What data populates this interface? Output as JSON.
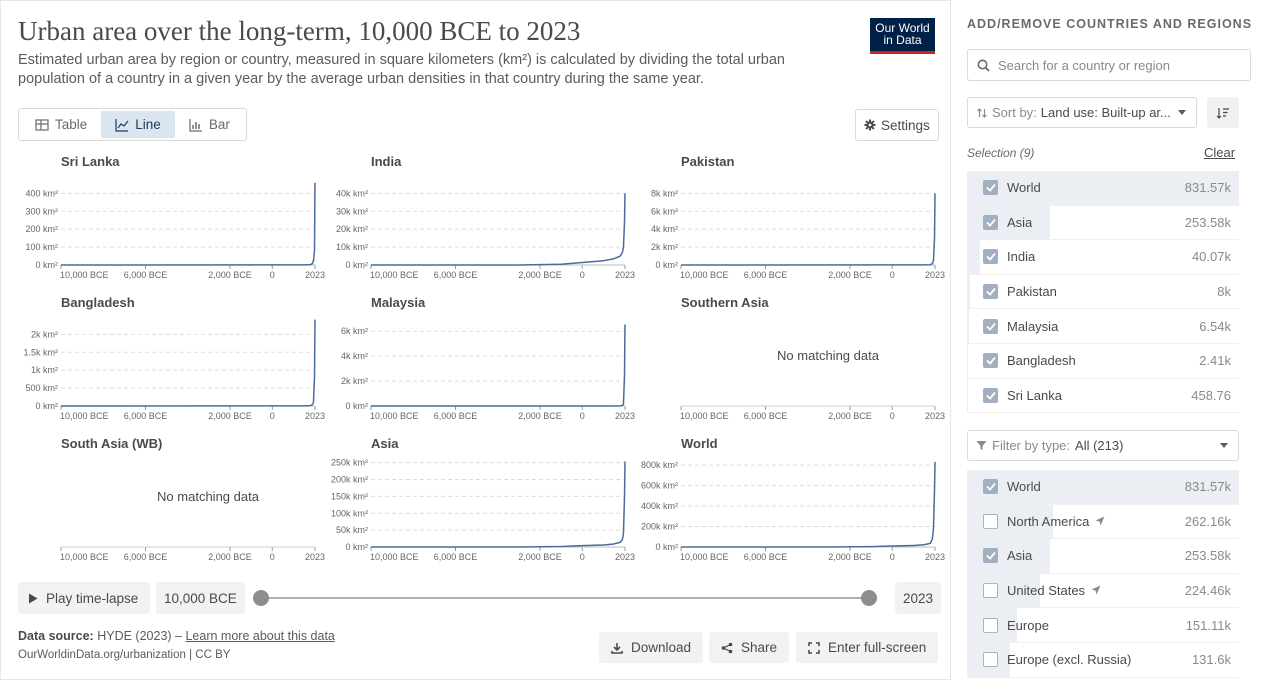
{
  "header": {
    "title": "Urban area over the long-term, 10,000 BCE to 2023",
    "subtitle": "Estimated urban area by region or country, measured in square kilometers (km²) is calculated by dividing the total urban population of a country in a given year by the average urban densities in that country during the same year.",
    "logo_line1": "Our World",
    "logo_line2": "in Data"
  },
  "tabs": [
    {
      "label": "Table",
      "icon": "table-icon",
      "active": false
    },
    {
      "label": "Line",
      "icon": "line-chart-icon",
      "active": true
    },
    {
      "label": "Bar",
      "icon": "bar-chart-icon",
      "active": false
    }
  ],
  "settings_label": "Settings",
  "no_data_text": "No matching data",
  "x_ticks": [
    "10,000 BCE",
    "6,000 BCE",
    "2,000 BCE",
    "0",
    "2023"
  ],
  "chart_data": {
    "type": "line",
    "layout": "small-multiples",
    "x_range": [
      -10000,
      2023
    ],
    "x_tick_values": [
      -10000,
      -6000,
      -2000,
      0,
      2023
    ],
    "line_color": "#4c6a9c",
    "grid": "horizontal dashed",
    "panels": [
      {
        "title": "Sri Lanka",
        "has_data": true,
        "y_ticks": [
          "400 km²",
          "300 km²",
          "200 km²",
          "100 km²",
          "0 km²"
        ],
        "y_tick_values": [
          400,
          300,
          200,
          100,
          0
        ],
        "ylim": [
          0,
          480
        ],
        "points": [
          [
            -10000,
            0
          ],
          [
            1500,
            0.5
          ],
          [
            1800,
            2
          ],
          [
            1900,
            8
          ],
          [
            1950,
            25
          ],
          [
            2000,
            80
          ],
          [
            2015,
            350
          ],
          [
            2023,
            458.76
          ]
        ]
      },
      {
        "title": "India",
        "has_data": true,
        "y_ticks": [
          "40k km²",
          "30k km²",
          "20k km²",
          "10k km²",
          "0 km²"
        ],
        "y_tick_values": [
          40000,
          30000,
          20000,
          10000,
          0
        ],
        "ylim": [
          0,
          48000
        ],
        "points": [
          [
            -10000,
            0
          ],
          [
            -3000,
            20
          ],
          [
            -1000,
            400
          ],
          [
            0,
            1400
          ],
          [
            1000,
            2400
          ],
          [
            1500,
            3500
          ],
          [
            1800,
            5000
          ],
          [
            1900,
            7000
          ],
          [
            1950,
            10000
          ],
          [
            2000,
            24000
          ],
          [
            2023,
            40070
          ]
        ]
      },
      {
        "title": "Pakistan",
        "has_data": true,
        "y_ticks": [
          "8k km²",
          "6k km²",
          "4k km²",
          "2k km²",
          "0 km²"
        ],
        "y_tick_values": [
          8000,
          6000,
          4000,
          2000,
          0
        ],
        "ylim": [
          0,
          9600
        ],
        "points": [
          [
            -10000,
            0
          ],
          [
            1500,
            10
          ],
          [
            1800,
            30
          ],
          [
            1900,
            150
          ],
          [
            1950,
            500
          ],
          [
            2000,
            3000
          ],
          [
            2023,
            8000
          ]
        ]
      },
      {
        "title": "Bangladesh",
        "has_data": true,
        "y_ticks": [
          "2k km²",
          "1.5k km²",
          "1k km²",
          "500 km²",
          "0 km²"
        ],
        "y_tick_values": [
          2000,
          1500,
          1000,
          500,
          0
        ],
        "ylim": [
          0,
          2400
        ],
        "points": [
          [
            -10000,
            0
          ],
          [
            1500,
            5
          ],
          [
            1800,
            10
          ],
          [
            1900,
            40
          ],
          [
            1950,
            100
          ],
          [
            2000,
            800
          ],
          [
            2023,
            2410
          ]
        ]
      },
      {
        "title": "Malaysia",
        "has_data": true,
        "y_ticks": [
          "6k km²",
          "4k km²",
          "2k km²",
          "0 km²"
        ],
        "y_tick_values": [
          6000,
          4000,
          2000,
          0
        ],
        "ylim": [
          0,
          6900
        ],
        "points": [
          [
            -10000,
            0
          ],
          [
            1500,
            5
          ],
          [
            1800,
            10
          ],
          [
            1900,
            40
          ],
          [
            1950,
            150
          ],
          [
            2000,
            2500
          ],
          [
            2023,
            6540
          ]
        ]
      },
      {
        "title": "Southern Asia",
        "has_data": false
      },
      {
        "title": "South Asia (WB)",
        "has_data": false
      },
      {
        "title": "Asia",
        "has_data": true,
        "y_ticks": [
          "250k km²",
          "200k km²",
          "150k km²",
          "100k km²",
          "50k km²",
          "0 km²"
        ],
        "y_tick_values": [
          250000,
          200000,
          150000,
          100000,
          50000,
          0
        ],
        "ylim": [
          0,
          255000
        ],
        "points": [
          [
            -10000,
            0
          ],
          [
            -3000,
            100
          ],
          [
            -1000,
            1500
          ],
          [
            0,
            4000
          ],
          [
            1000,
            6000
          ],
          [
            1500,
            9000
          ],
          [
            1800,
            14000
          ],
          [
            1900,
            22000
          ],
          [
            1950,
            40000
          ],
          [
            2000,
            150000
          ],
          [
            2023,
            253580
          ]
        ]
      },
      {
        "title": "World",
        "has_data": true,
        "y_ticks": [
          "800k km²",
          "600k km²",
          "400k km²",
          "200k km²",
          "0 km²"
        ],
        "y_tick_values": [
          800000,
          600000,
          400000,
          200000,
          0
        ],
        "ylim": [
          0,
          840000
        ],
        "points": [
          [
            -10000,
            0
          ],
          [
            -3000,
            300
          ],
          [
            -1000,
            4000
          ],
          [
            0,
            10000
          ],
          [
            1000,
            15000
          ],
          [
            1500,
            22000
          ],
          [
            1800,
            35000
          ],
          [
            1900,
            80000
          ],
          [
            1950,
            180000
          ],
          [
            2000,
            550000
          ],
          [
            2023,
            831570
          ]
        ]
      }
    ]
  },
  "timeline": {
    "play_label": "Play time-lapse",
    "start_label": "10,000 BCE",
    "end_label": "2023"
  },
  "footer": {
    "source_prefix": "Data source:",
    "source_value": "HYDE (2023) –",
    "source_link": "Learn more about this data",
    "url": "OurWorldinData.org/urbanization | CC BY",
    "download_label": "Download",
    "share_label": "Share",
    "fullscreen_label": "Enter full-screen"
  },
  "sidebar": {
    "header": "ADD/REMOVE COUNTRIES AND REGIONS",
    "search_placeholder": "Search for a country or region",
    "sort_prefix": "Sort by:",
    "sort_value": "Land use: Built-up ar...",
    "selection_label": "Selection (9)",
    "clear_label": "Clear",
    "selected": [
      {
        "name": "World",
        "value": "831.57k",
        "checked": true,
        "fraction": 1.0
      },
      {
        "name": "Asia",
        "value": "253.58k",
        "checked": true,
        "fraction": 0.305
      },
      {
        "name": "India",
        "value": "40.07k",
        "checked": true,
        "fraction": 0.048
      },
      {
        "name": "Pakistan",
        "value": "8k",
        "checked": true,
        "fraction": 0.01
      },
      {
        "name": "Malaysia",
        "value": "6.54k",
        "checked": true,
        "fraction": 0.008
      },
      {
        "name": "Bangladesh",
        "value": "2.41k",
        "checked": true,
        "fraction": 0.003
      },
      {
        "name": "Sri Lanka",
        "value": "458.76",
        "checked": true,
        "fraction": 0.0006
      }
    ],
    "filter_prefix": "Filter by type:",
    "filter_value": "All (213)",
    "all_entities": [
      {
        "name": "World",
        "value": "831.57k",
        "checked": true,
        "fraction": 1.0,
        "arrow": false
      },
      {
        "name": "North America",
        "value": "262.16k",
        "checked": false,
        "fraction": 0.315,
        "arrow": true
      },
      {
        "name": "Asia",
        "value": "253.58k",
        "checked": true,
        "fraction": 0.305,
        "arrow": false
      },
      {
        "name": "United States",
        "value": "224.46k",
        "checked": false,
        "fraction": 0.27,
        "arrow": true
      },
      {
        "name": "Europe",
        "value": "151.11k",
        "checked": false,
        "fraction": 0.182,
        "arrow": false
      },
      {
        "name": "Europe (excl. Russia)",
        "value": "131.6k",
        "checked": false,
        "fraction": 0.158,
        "arrow": false
      }
    ]
  }
}
